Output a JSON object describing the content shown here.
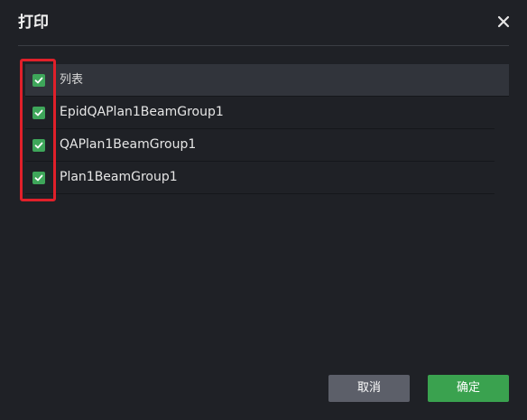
{
  "dialog": {
    "title": "打印",
    "close_icon": "close-icon"
  },
  "table": {
    "header": {
      "label": "列表",
      "checked": true
    },
    "rows": [
      {
        "label": "EpidQAPlan1BeamGroup1",
        "checked": true
      },
      {
        "label": "QAPlan1BeamGroup1",
        "checked": true
      },
      {
        "label": "Plan1BeamGroup1",
        "checked": true
      }
    ]
  },
  "buttons": {
    "cancel_label": "取消",
    "ok_label": "确定"
  },
  "colors": {
    "background": "#1f2126",
    "header_row": "#31343b",
    "checkbox": "#3ea65a",
    "ok_button": "#3aa24f",
    "cancel_button": "#5c5f69",
    "highlight": "#e0202a"
  }
}
